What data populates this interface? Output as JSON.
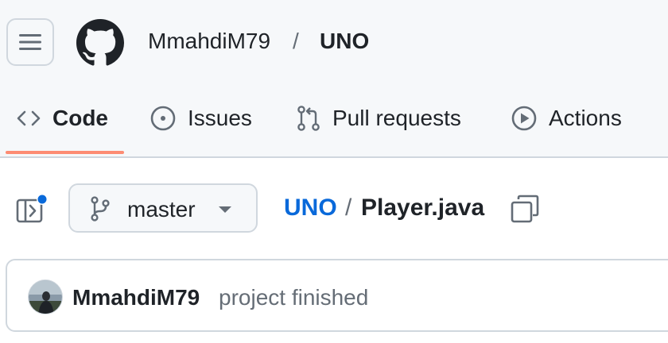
{
  "header": {
    "owner": "MmahdiM79",
    "separator": "/",
    "repo": "UNO"
  },
  "tabs": [
    {
      "label": "Code",
      "icon": "code-icon",
      "active": true
    },
    {
      "label": "Issues",
      "icon": "issue-opened-icon",
      "active": false
    },
    {
      "label": "Pull requests",
      "icon": "git-pull-request-icon",
      "active": false
    },
    {
      "label": "Actions",
      "icon": "play-icon",
      "active": false
    }
  ],
  "file_nav": {
    "branch": "master",
    "breadcrumb_repo": "UNO",
    "breadcrumb_separator": "/",
    "file_name": "Player.java"
  },
  "commit": {
    "author": "MmahdiM79",
    "message": "project finished"
  },
  "colors": {
    "accent_link": "#0969da",
    "active_tab_underline": "#fd8c73",
    "notification_dot": "#0969da",
    "header_bg": "#f6f8fa",
    "border": "#d0d7de"
  }
}
